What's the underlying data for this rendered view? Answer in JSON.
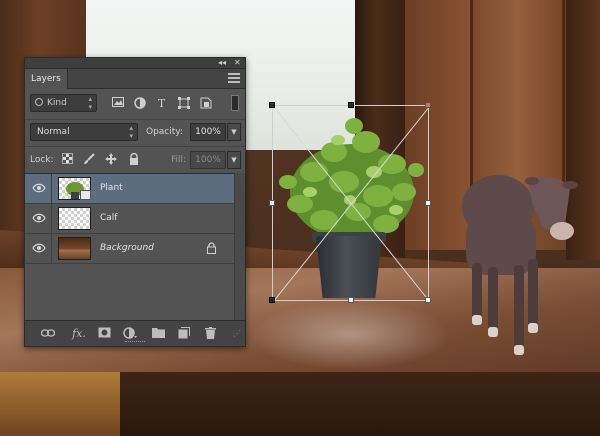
{
  "panel": {
    "tab_title": "Layers",
    "collapse_label": "◂◂",
    "close_label": "✕"
  },
  "filter": {
    "kind_label": "Kind"
  },
  "blend": {
    "mode": "Normal",
    "opacity_label": "Opacity:",
    "opacity_value": "100%"
  },
  "lock": {
    "label": "Lock:",
    "fill_label": "Fill:",
    "fill_value": "100%"
  },
  "layers": [
    {
      "name": "Plant",
      "selected": true,
      "type": "smart-object"
    },
    {
      "name": "Calf",
      "selected": false,
      "type": "pixel"
    },
    {
      "name": "Background",
      "selected": false,
      "type": "background",
      "locked": true
    }
  ],
  "footer_icons": [
    "link-icon",
    "fx-icon",
    "mask-icon",
    "adjustment-icon",
    "folder-icon",
    "new-layer-icon",
    "trash-icon"
  ],
  "colors": {
    "panel_bg": "#535353",
    "selected_row": "#5e6c80"
  }
}
